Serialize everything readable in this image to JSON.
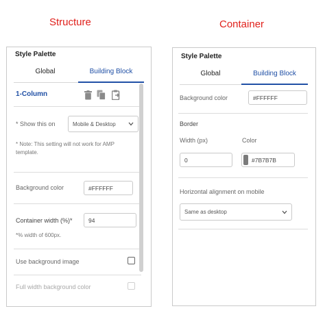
{
  "captions": {
    "left": "Structure",
    "right": "Container"
  },
  "structure_panel": {
    "title": "Style Palette",
    "tabs": [
      {
        "label": "Global"
      },
      {
        "label": "Building Block"
      }
    ],
    "active_tab": "Building Block",
    "block_name": "1-Column",
    "icons": [
      "trash-icon",
      "copy-icon",
      "save-template-icon"
    ],
    "show_this_on": {
      "label": "* Show this on",
      "value": "Mobile & Desktop"
    },
    "note": "* Note: This setting will not work for AMP template.",
    "background_color": {
      "label": "Background color",
      "value": "#FFFFFF"
    },
    "container_width": {
      "label": "Container width (%)*",
      "value": "94",
      "hint": "*% width of 600px."
    },
    "use_background_image": {
      "label": "Use background image",
      "checked": false
    },
    "full_width_background_color": {
      "label": "Full width background color",
      "checked": false
    }
  },
  "container_panel": {
    "title": "Style Palette",
    "tabs": [
      {
        "label": "Global"
      },
      {
        "label": "Building Block"
      }
    ],
    "active_tab": "Building Block",
    "background_color": {
      "label": "Background color",
      "value": "#FFFFFF"
    },
    "border": {
      "heading": "Border",
      "width_label": "Width (px)",
      "width_value": "0",
      "color_label": "Color",
      "color_value": "#7B7B7B"
    },
    "horizontal_alignment": {
      "label": "Horizontal alignment on mobile",
      "value": "Same as desktop"
    }
  },
  "colors": {
    "caption": "#e0201b",
    "accent": "#1f4fa5",
    "border_swatch": "#7b7b7b"
  }
}
